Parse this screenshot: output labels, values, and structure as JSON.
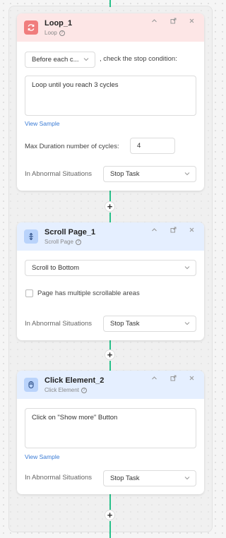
{
  "loop_card": {
    "title": "Loop_1",
    "subtitle": "Loop",
    "mode_select": "Before each c...",
    "mode_suffix": ", check the stop condition:",
    "condition_text": "Loop until you reach 3 cycles",
    "view_sample": "View Sample",
    "max_label": "Max Duration number of cycles:",
    "max_value": "4",
    "abnormal_label": "In Abnormal Situations",
    "abnormal_value": "Stop Task"
  },
  "scroll_card": {
    "title": "Scroll Page_1",
    "subtitle": "Scroll Page",
    "scroll_select": "Scroll to Bottom",
    "checkbox_label": "Page has multiple scrollable areas",
    "abnormal_label": "In Abnormal Situations",
    "abnormal_value": "Stop Task"
  },
  "click_card": {
    "title": "Click Element_2",
    "subtitle": "Click Element",
    "instruction": "Click on \"Show more\" Button",
    "view_sample": "View Sample",
    "abnormal_label": "In Abnormal Situations",
    "abnormal_value": "Stop Task"
  },
  "icons": {
    "loop": "refresh-icon",
    "scroll": "scroll-icon",
    "click": "mouse-icon",
    "add": "plus-icon"
  },
  "colors": {
    "connector": "#27c08a",
    "loop_header": "#fde6e6",
    "step_header": "#e5efff",
    "link": "#3a7bd5"
  }
}
